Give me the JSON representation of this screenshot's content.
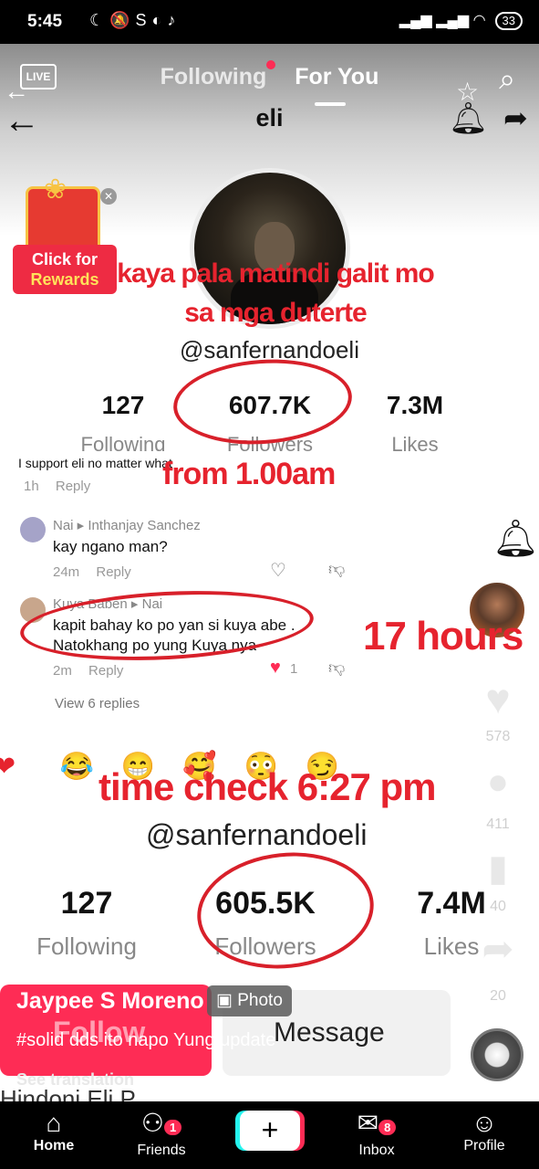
{
  "status_bar": {
    "time": "5:45",
    "battery": "33"
  },
  "feed_tabs": {
    "following": "Following",
    "for_you": "For You"
  },
  "live_label": "LIVE",
  "profile_screenshot": {
    "header_name": "eli",
    "handle": "@sanfernandoeli",
    "stats": [
      {
        "value": "127",
        "label": "Following"
      },
      {
        "value": "607.7K",
        "label": "Followers"
      },
      {
        "value": "7.3M",
        "label": "Likes"
      }
    ]
  },
  "reward_badge": {
    "line1": "Click for",
    "line2": "Rewards"
  },
  "overlay_texts": {
    "caption1": "kaya pala matindi galit mo sa mga duterte",
    "from_time": "from 1.00am",
    "hours": "17 hours",
    "time_check": "time check 6:27 pm"
  },
  "comments": [
    {
      "text": "I support eli no matter what",
      "time": "1h",
      "reply": "Reply"
    },
    {
      "name": "Nai",
      "reply_to": "Inthanjay Sanchez",
      "text": "kay ngano man?",
      "time": "24m",
      "reply": "Reply"
    },
    {
      "name": "Kuya Baben",
      "reply_to": "Nai",
      "text": "kapit bahay ko po yan si kuya abe . Natokhang po yung Kuya nya",
      "time": "2m",
      "reply": "Reply",
      "likes": "1"
    }
  ],
  "view_replies": "View 6 replies",
  "profile_screenshot_2": {
    "handle": "@sanfernandoeli",
    "stats": [
      {
        "value": "127",
        "label": "Following"
      },
      {
        "value": "605.5K",
        "label": "Followers"
      },
      {
        "value": "7.4M",
        "label": "Likes"
      }
    ],
    "follow_button": "Follow",
    "message_button": "Message"
  },
  "side_actions": {
    "likes": "578",
    "comments": "411",
    "saves": "40",
    "shares": "20"
  },
  "post": {
    "author": "Jaypee S Moreno",
    "badge": "Photo",
    "caption": "#solid dds ito napo Yung update",
    "see_translation": "See translation",
    "cutoff_text": "Hindoni Eli P..."
  },
  "nav": [
    {
      "label": "Home"
    },
    {
      "label": "Friends",
      "badge": "1"
    },
    {
      "label": ""
    },
    {
      "label": "Inbox",
      "badge": "8"
    },
    {
      "label": "Profile"
    }
  ],
  "colors": {
    "accent": "#fe2c55",
    "annotation_red": "#e6232e",
    "cyan": "#25f4ee"
  }
}
